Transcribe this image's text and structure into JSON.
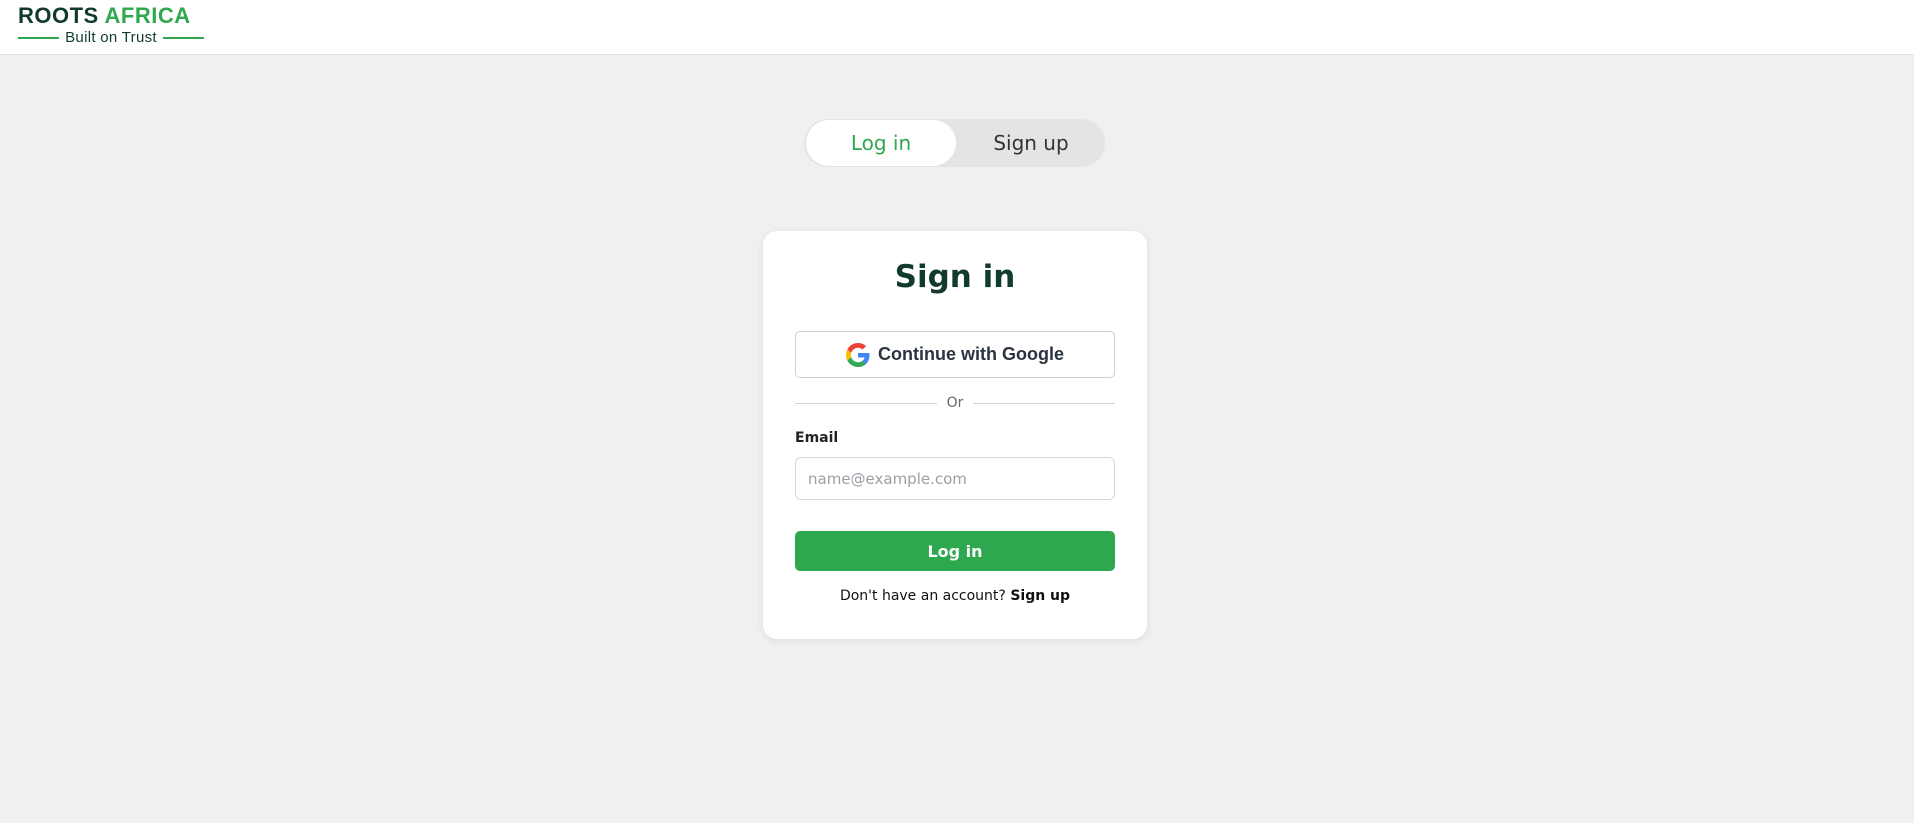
{
  "brand": {
    "name_part1": "ROOTS",
    "name_part2": "AFRICA",
    "tagline": "Built on Trust",
    "dark_color": "#123b2e",
    "accent_color": "#2fa84f"
  },
  "auth_toggle": {
    "login_label": "Log in",
    "signup_label": "Sign up",
    "active": "login"
  },
  "card": {
    "title": "Sign in",
    "google_button_label": "Continue with Google",
    "google_icon": "google-g-icon",
    "divider_text": "Or",
    "email_label": "Email",
    "email_value": "",
    "email_placeholder": "name@example.com",
    "submit_label": "Log in",
    "no_account_text": "Don't have an account?",
    "signup_link": "Sign up"
  },
  "colors": {
    "page_bg": "#f0f0f0",
    "primary_button": "#2ea84f"
  }
}
